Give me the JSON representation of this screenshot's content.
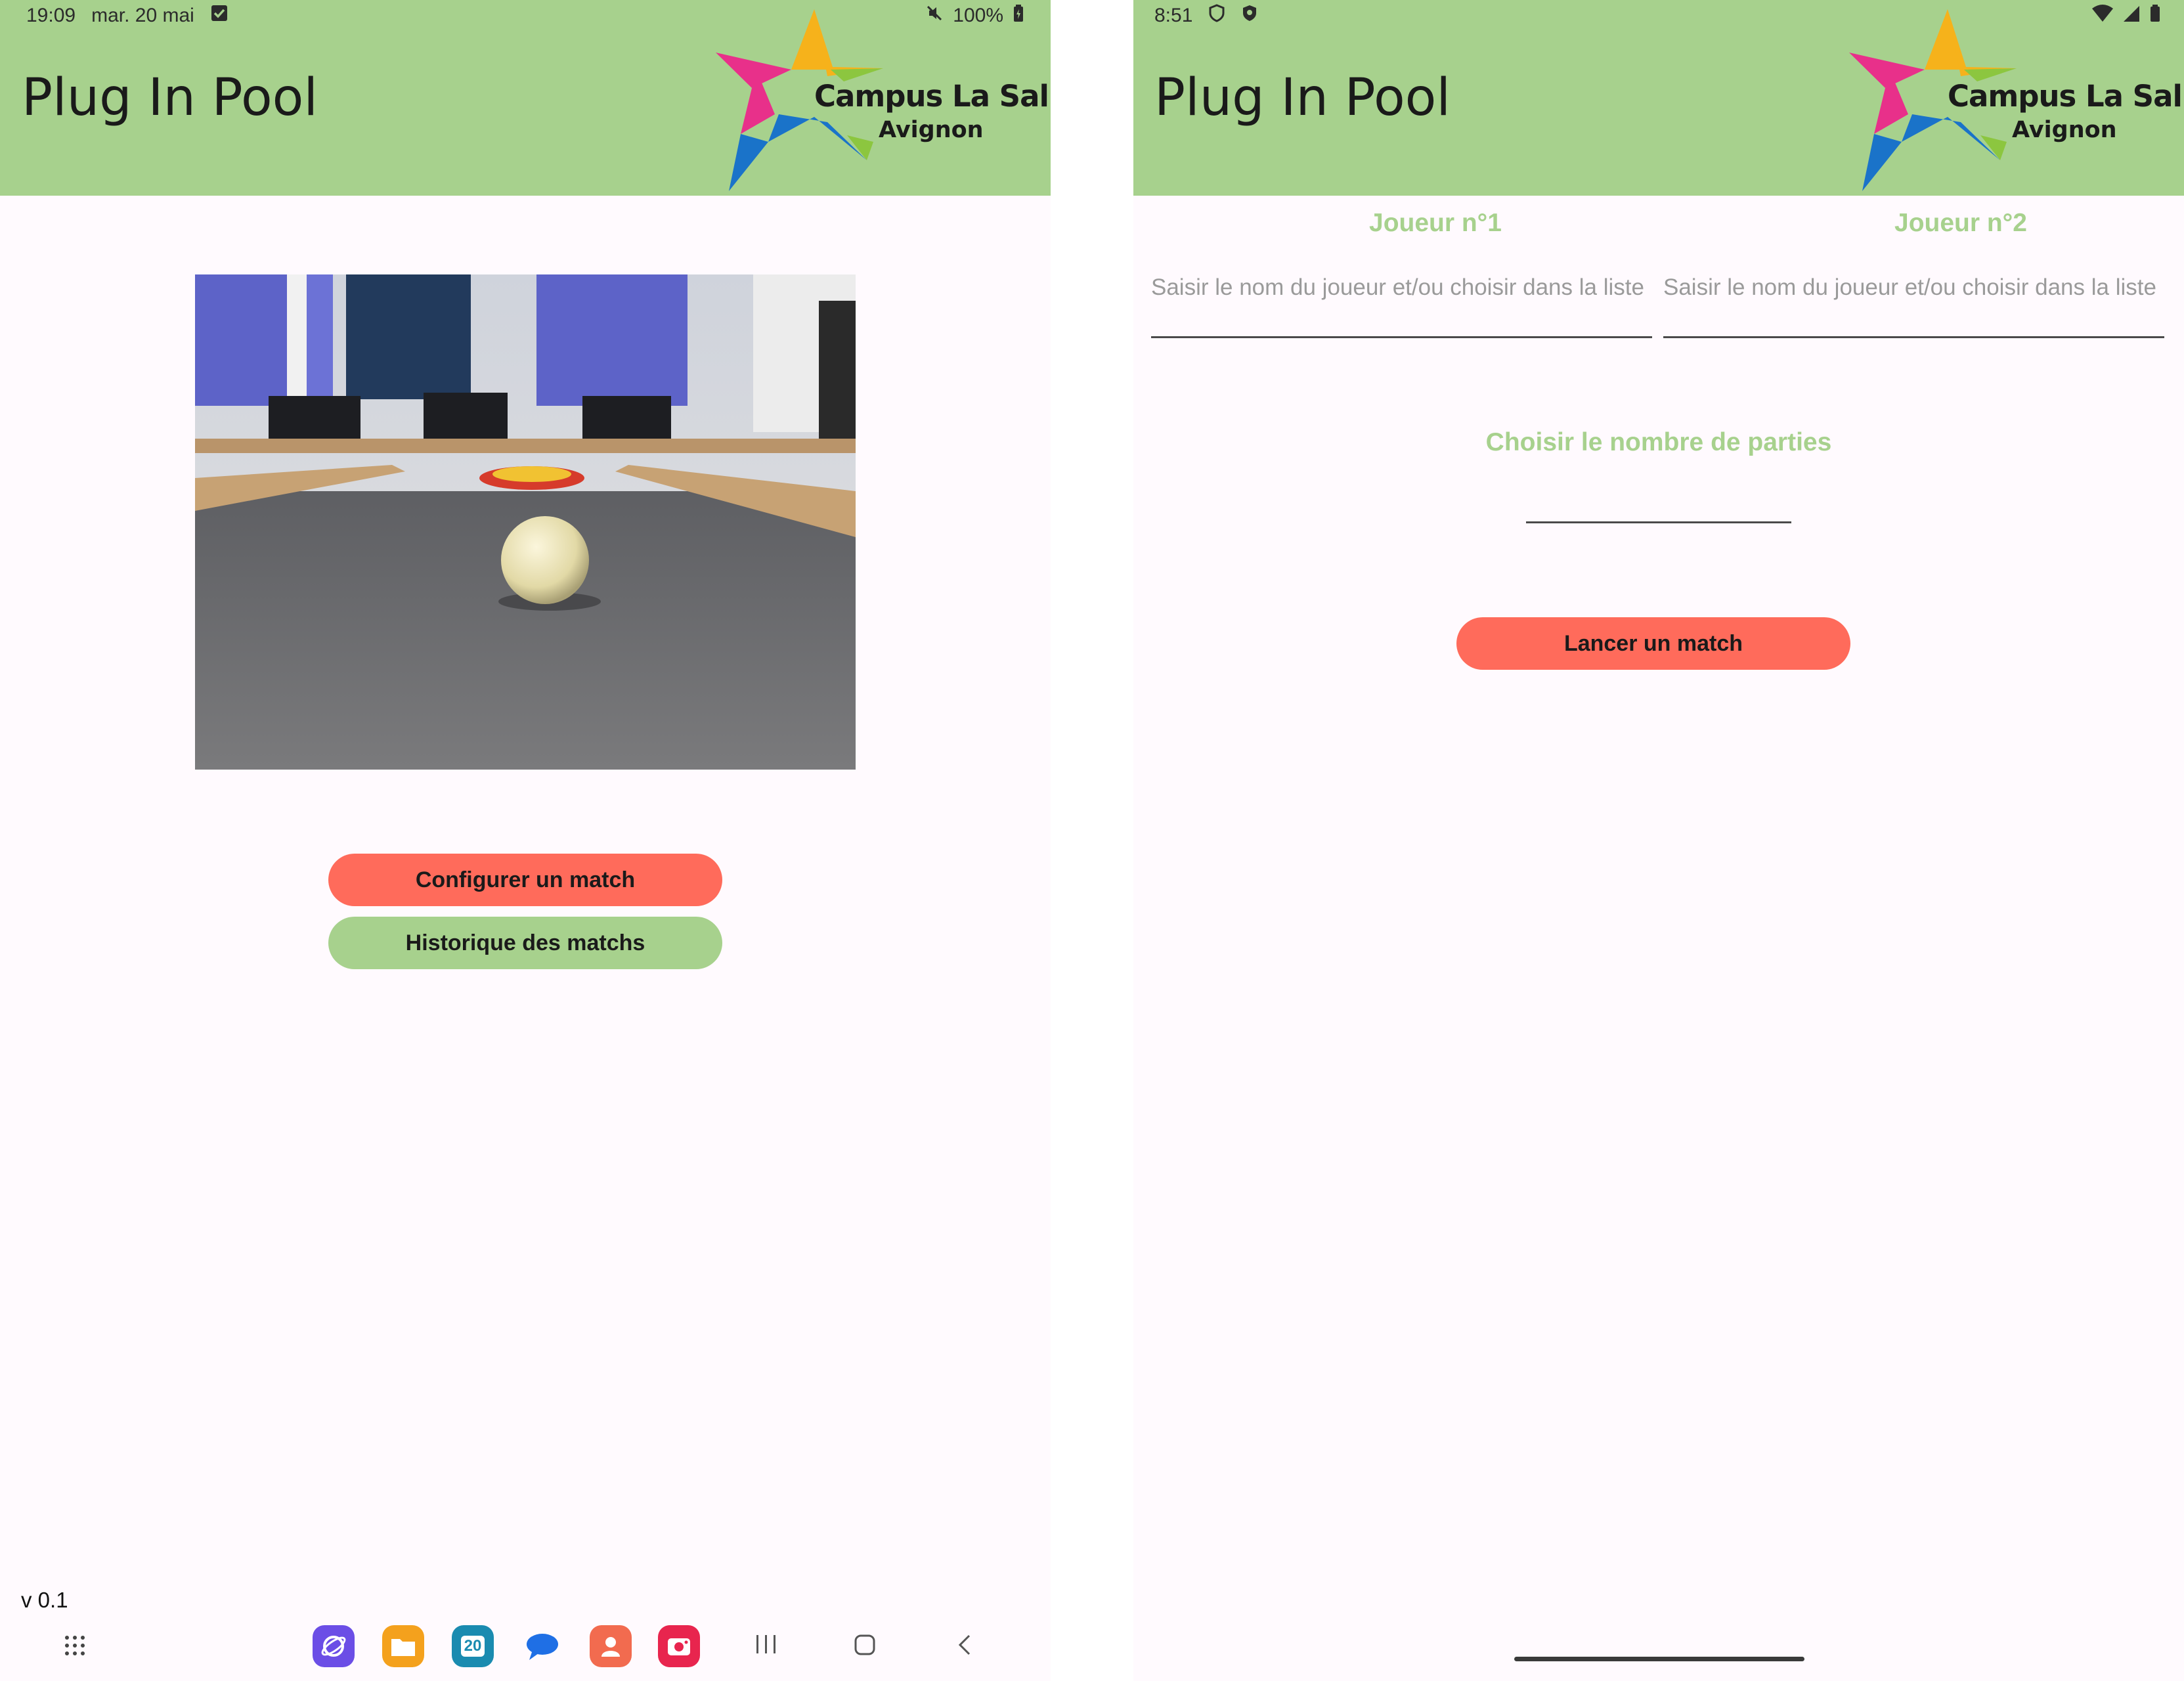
{
  "app": {
    "title": "Plug In Pool",
    "logo_line1": "Campus La Salle",
    "logo_line2": "Avignon",
    "colors": {
      "appbar": "#a7d18d",
      "primary_button": "#ff6b5b",
      "secondary_button": "#a7d18d",
      "background": "#fffafe"
    }
  },
  "home": {
    "status": {
      "time": "19:09",
      "date": "mar. 20 mai",
      "battery": "100%"
    },
    "image_name": "pool-table-photo",
    "configure_label": "Configurer un match",
    "history_label": "Historique des matchs",
    "version": "v 0.1",
    "dock": [
      {
        "name": "internet-app-icon"
      },
      {
        "name": "my-files-app-icon"
      },
      {
        "name": "calendar-app-icon",
        "text": "20"
      },
      {
        "name": "messages-app-icon"
      },
      {
        "name": "contacts-app-icon"
      },
      {
        "name": "screen-recorder-app-icon"
      }
    ]
  },
  "config": {
    "status": {
      "time": "8:51"
    },
    "player1_label": "Joueur n°1",
    "player2_label": "Joueur n°2",
    "player_placeholder": "Saisir le nom du joueur et/ou choisir dans la liste",
    "parties_label": "Choisir le nombre de parties",
    "launch_label": "Lancer un match"
  }
}
